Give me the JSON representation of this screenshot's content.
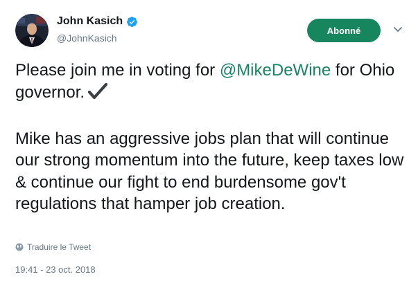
{
  "author": {
    "name": "John Kasich",
    "handle": "@JohnKasich",
    "verified": true,
    "avatar_icon": "profile-photo"
  },
  "follow_button": {
    "label": "Abonné"
  },
  "tweet": {
    "paragraph1_before": "Please join me in voting for ",
    "mention": "@MikeDeWine",
    "paragraph1_after": " for Ohio governor.",
    "paragraph1_icon": "heavy-check-mark",
    "paragraph2": "Mike has an aggressive jobs plan that will continue our strong momentum into the future, keep taxes low & continue our fight to end burdensome gov't regulations that hamper job creation."
  },
  "translate_link": {
    "label": "Traduire le Tweet",
    "icon": "globe-icon"
  },
  "timestamp": "19:41 - 23 oct. 2018",
  "colors": {
    "accent": "#17855d",
    "text": "#14171a",
    "muted": "#657786",
    "verified": "#1da1f2"
  }
}
